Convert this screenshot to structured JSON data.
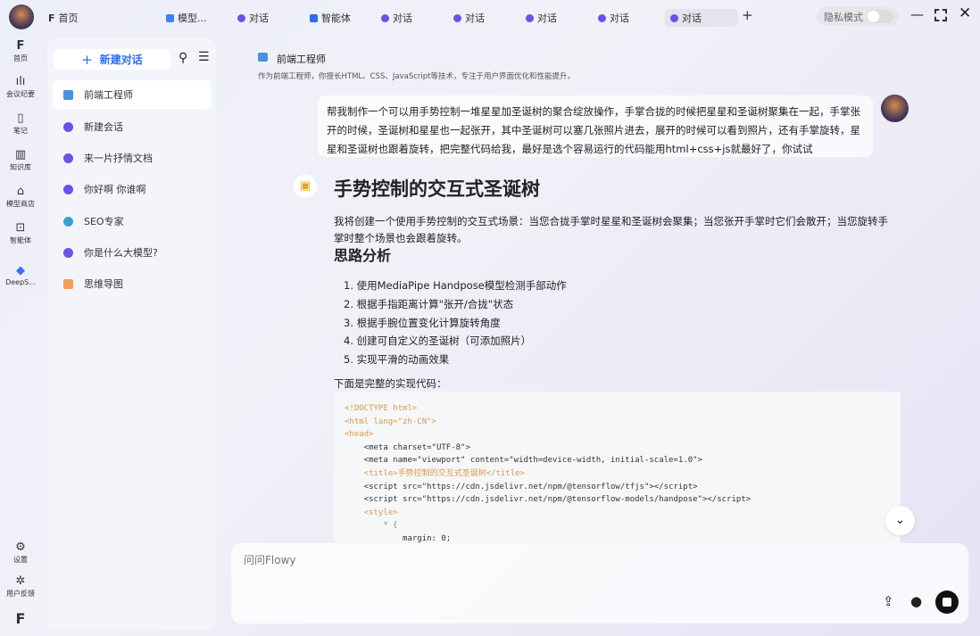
{
  "tabs": [
    {
      "label": "首页"
    },
    {
      "label": "模型..."
    },
    {
      "label": "对话"
    },
    {
      "label": "智能体"
    },
    {
      "label": "对话"
    },
    {
      "label": "对话"
    },
    {
      "label": "对话"
    },
    {
      "label": "对话"
    },
    {
      "label": "对话"
    }
  ],
  "privacy_label": "隐私模式",
  "rail": [
    {
      "label": "首页"
    },
    {
      "label": "会议纪要"
    },
    {
      "label": "笔记"
    },
    {
      "label": "知识库"
    },
    {
      "label": "模型商店"
    },
    {
      "label": "智能体"
    },
    {
      "label": "DeepS..."
    },
    {
      "label": "设置"
    },
    {
      "label": "用户反馈"
    }
  ],
  "sidebar": {
    "new_chat": "新建对话",
    "items": [
      {
        "label": "前端工程师"
      },
      {
        "label": "新建会话"
      },
      {
        "label": "来一片抒情文档"
      },
      {
        "label": "你好啊 你谁啊"
      },
      {
        "label": "SEO专家"
      },
      {
        "label": "你是什么大模型?"
      },
      {
        "label": "思维导图"
      }
    ]
  },
  "agent": {
    "name": "前端工程师",
    "desc": "作为前端工程师，你擅长HTML、CSS、JavaScript等技术，专注于用户界面优化和性能提升。"
  },
  "user_message": "帮我制作一个可以用手势控制一堆星星加圣诞树的聚合绽放操作，手掌合拢的时候把星星和圣诞树聚集在一起，手掌张开的时候，圣诞树和星星也一起张开，其中圣诞树可以塞几张照片进去，展开的时候可以看到照片，还有手掌旋转，星星和圣诞树也跟着旋转，把完整代码给我，最好是选个容易运行的代码能用html+css+js就最好了，你试试",
  "reply": {
    "title": "手势控制的交互式圣诞树",
    "intro": "我将创建一个使用手势控制的交互式场景：当您合拢手掌时星星和圣诞树会聚集；当您张开手掌时它们会散开；当您旋转手掌时整个场景也会跟着旋转。",
    "section": "思路分析",
    "steps": [
      "1. 使用MediaPipe Handpose模型检测手部动作",
      "2. 根据手指距离计算\"张开/合拢\"状态",
      "3. 根据手腕位置变化计算旋转角度",
      "4. 创建可自定义的圣诞树（可添加照片）",
      "5. 实现平滑的动画效果"
    ],
    "code_intro": "下面是完整的实现代码：",
    "code_lines": [
      "<!DOCTYPE html>",
      "<html lang=\"zh-CN\">",
      "<head>",
      "    <meta charset=\"UTF-8\">",
      "    <meta name=\"viewport\" content=\"width=device-width, initial-scale=1.0\">",
      "    <title>手势控制的交互式圣诞树</title>",
      "    <script src=\"https://cdn.jsdelivr.net/npm/@tensorflow/tfjs\"></script>",
      "    <script src=\"https://cdn.jsdelivr.net/npm/@tensorflow-models/handpose\"></script>",
      "    <style>",
      "        * {",
      "            margin: 0;"
    ]
  },
  "input": {
    "placeholder": "问问Flowy"
  }
}
